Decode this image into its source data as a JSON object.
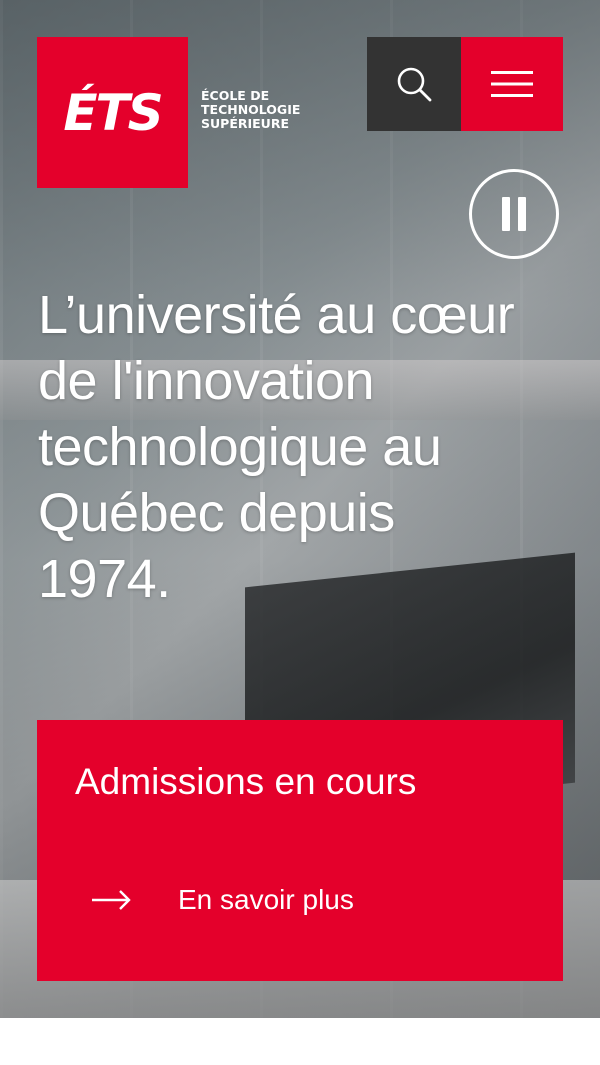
{
  "header": {
    "logo_text": "ÉTS",
    "school_name": [
      "ÉCOLE DE",
      "TECHNOLOGIE",
      "SUPÉRIEURE"
    ],
    "search_aria": "Rechercher",
    "menu_aria": "Menu"
  },
  "hero": {
    "headline": "L’université au cœur de l'innovation technologique au Québec depuis 1974.",
    "pause_aria": "Pause"
  },
  "promo": {
    "title": "Admissions en cours",
    "link_label": "En savoir plus"
  },
  "colors": {
    "brand_red": "#e4002b",
    "dark_gray": "#333333",
    "white": "#ffffff"
  },
  "icons": {
    "search": "search-icon",
    "menu": "hamburger-menu-icon",
    "pause": "pause-icon",
    "arrow": "arrow-right-icon"
  }
}
